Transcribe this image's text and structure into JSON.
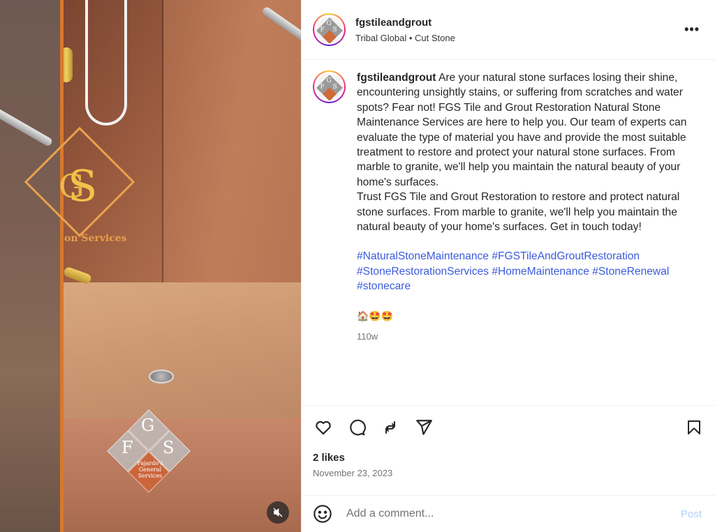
{
  "post": {
    "username": "fgstileandgrout",
    "location": "Tribal Global • Cut Stone",
    "more_icon": "•••",
    "caption": {
      "username": "fgstileandgrout",
      "text": " Are your natural stone surfaces losing their shine, encountering unsightly stains, or suffering from scratches and water spots? Fear not! FGS Tile and Grout Restoration Natural Stone Maintenance Services are here to help you. Our team of experts can evaluate the type of material you have and provide the most suitable treatment to restore and protect your natural stone surfaces. From marble to granite, we'll help you maintain the natural beauty of your home's surfaces.\nTrust FGS Tile and Grout Restoration to restore and protect natural stone surfaces. From marble to granite, we'll help you maintain the natural beauty of your home's surfaces. Get in touch today!",
      "hashtags": [
        "#NaturalStoneMaintenance",
        "#FGSTileAndGroutRestoration",
        "#StoneRestorationServices",
        "#HomeMaintenance",
        "#StoneRenewal",
        "#stonecare"
      ],
      "emojis": "🏠🤩🤩",
      "time_ago": "110w"
    },
    "likes": "2 likes",
    "date": "November 23, 2023",
    "comment": {
      "placeholder": "Add a comment...",
      "post_label": "Post"
    }
  },
  "media": {
    "watermark": {
      "letter_g": "G",
      "letter_f": "F",
      "letter_s": "S",
      "subtitle": "Fajardo's General Services"
    },
    "sign": {
      "big_g": "G",
      "big_s": "S",
      "services": "on Services"
    }
  },
  "avatar": {
    "letter_g": "G",
    "letter_f": "F",
    "letter_s": "S"
  },
  "colors": {
    "link": "#3b5bdb",
    "muted": "#737373",
    "post_disabled": "#b3cff8",
    "accent_orange": "#d9782c"
  },
  "icons": [
    "heart-icon",
    "comment-icon",
    "share-icon",
    "send-icon",
    "bookmark-icon",
    "emoji-icon",
    "mute-icon",
    "more-icon"
  ]
}
